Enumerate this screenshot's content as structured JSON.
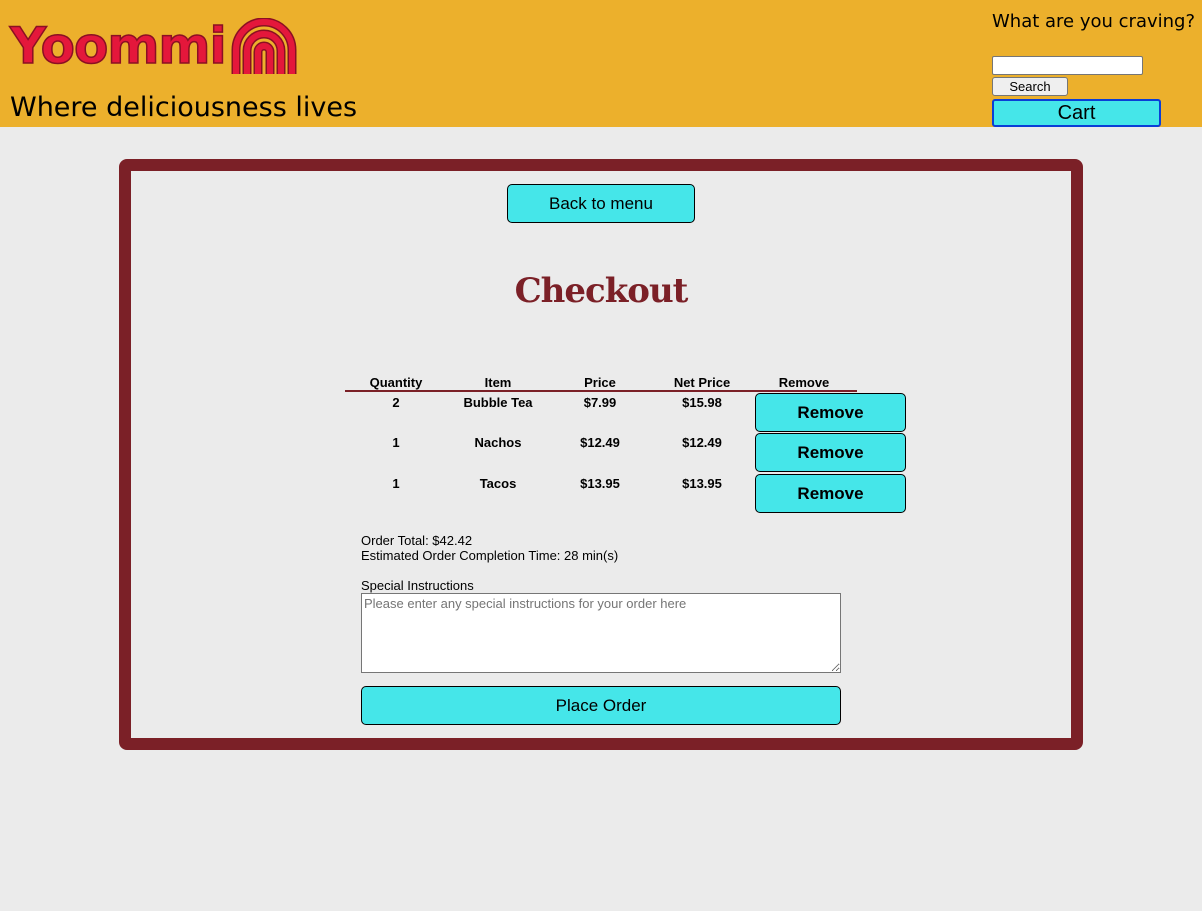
{
  "header": {
    "logo_text": "Yoommi",
    "tagline": "Where deliciousness lives",
    "search_prompt": "What are you craving?",
    "search_value": "",
    "search_button": "Search",
    "cart_button": "Cart"
  },
  "checkout": {
    "back_button": "Back to menu",
    "title": "Checkout",
    "columns": [
      "Quantity",
      "Item",
      "Price",
      "Net Price",
      "Remove"
    ],
    "rows": [
      {
        "quantity": "2",
        "item": "Bubble Tea",
        "price": "$7.99",
        "net": "$15.98",
        "remove": "Remove"
      },
      {
        "quantity": "1",
        "item": "Nachos",
        "price": "$12.49",
        "net": "$12.49",
        "remove": "Remove"
      },
      {
        "quantity": "1",
        "item": "Tacos",
        "price": "$13.95",
        "net": "$13.95",
        "remove": "Remove"
      }
    ],
    "order_total": "Order Total: $42.42",
    "completion_time": "Estimated Order Completion Time: 28 min(s)",
    "instructions_label": "Special Instructions",
    "instructions_placeholder": "Please enter any special instructions for your order here",
    "instructions_value": "",
    "place_order_button": "Place Order"
  },
  "colors": {
    "header_bg": "#ecb02c",
    "accent_cyan": "#45e6e9",
    "panel_border": "#7b2027",
    "logo_red": "#e4173b"
  }
}
